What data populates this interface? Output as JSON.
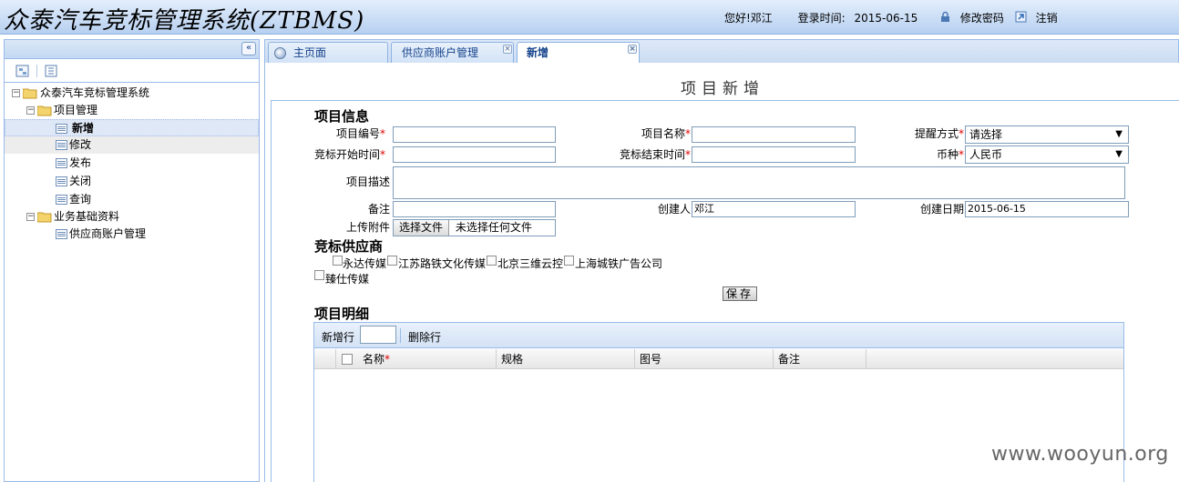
{
  "header": {
    "app_title": "众泰汽车竞标管理系统(ZTBMS)",
    "greeting": "您好!邓江",
    "login_time_label": "登录时间:",
    "login_time": "2015-06-15",
    "change_password": "修改密码",
    "logout": "注销"
  },
  "sidebar": {
    "collapse_glyph": "«",
    "tree": [
      {
        "label": "众泰汽车竞标管理系统",
        "toggle": "−"
      },
      {
        "label": "项目管理",
        "toggle": "−"
      },
      {
        "label": "新增"
      },
      {
        "label": "修改"
      },
      {
        "label": "发布"
      },
      {
        "label": "关闭"
      },
      {
        "label": "查询"
      },
      {
        "label": "业务基础资料",
        "toggle": "−"
      },
      {
        "label": "供应商账户管理"
      }
    ]
  },
  "tabs": [
    {
      "label": "主页面"
    },
    {
      "label": "供应商账户管理"
    },
    {
      "label": "新增"
    }
  ],
  "tab_close_glyph": "×",
  "page": {
    "title": "项目新增",
    "section_project_info": "项目信息",
    "fields": {
      "project_no": "项目编号",
      "project_name": "项目名称",
      "remind_method": "提醒方式",
      "remind_method_value": "请选择",
      "bid_start": "竞标开始时间",
      "bid_end": "竞标结束时间",
      "currency": "币种",
      "currency_value": "人民币",
      "description": "项目描述",
      "remark": "备注",
      "creator": "创建人",
      "creator_value": "邓江",
      "create_date": "创建日期",
      "create_date_value": "2015-06-15",
      "attachment": "上传附件",
      "choose_file": "选择文件",
      "no_file": "未选择任何文件"
    },
    "required_mark": "*",
    "select_arrow": "▼",
    "section_suppliers": "竞标供应商",
    "suppliers": [
      "永达传媒",
      "江苏路铁文化传媒",
      "北京三维云控",
      "上海城铁广告公司",
      "臻仕传媒"
    ],
    "save_button": "保存",
    "section_details": "项目明细",
    "grid": {
      "add_row": "新增行",
      "delete_row": "删除行",
      "columns": [
        "名称",
        "规格",
        "图号",
        "备注"
      ]
    }
  },
  "watermark": "www.wooyun.org"
}
